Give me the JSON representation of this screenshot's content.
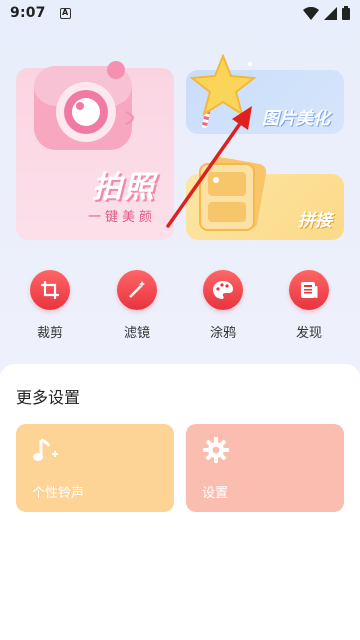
{
  "status_bar": {
    "time": "9:07",
    "notification_icon": "A"
  },
  "cards": {
    "camera": {
      "title": "拍照",
      "subtitle": "一键美颜"
    },
    "beautify": {
      "title": "图片美化"
    },
    "collage": {
      "title": "拼接"
    }
  },
  "tools": [
    {
      "label": "裁剪",
      "icon": "crop-icon"
    },
    {
      "label": "滤镜",
      "icon": "magic-wand-icon"
    },
    {
      "label": "涂鸦",
      "icon": "palette-icon"
    },
    {
      "label": "发现",
      "icon": "news-icon"
    }
  ],
  "more_settings": {
    "title": "更多设置",
    "ringtone_label": "个性铃声",
    "settings_label": "设置"
  },
  "colors": {
    "accent_red": "#e8343f",
    "annotation_arrow": "#e02020"
  }
}
